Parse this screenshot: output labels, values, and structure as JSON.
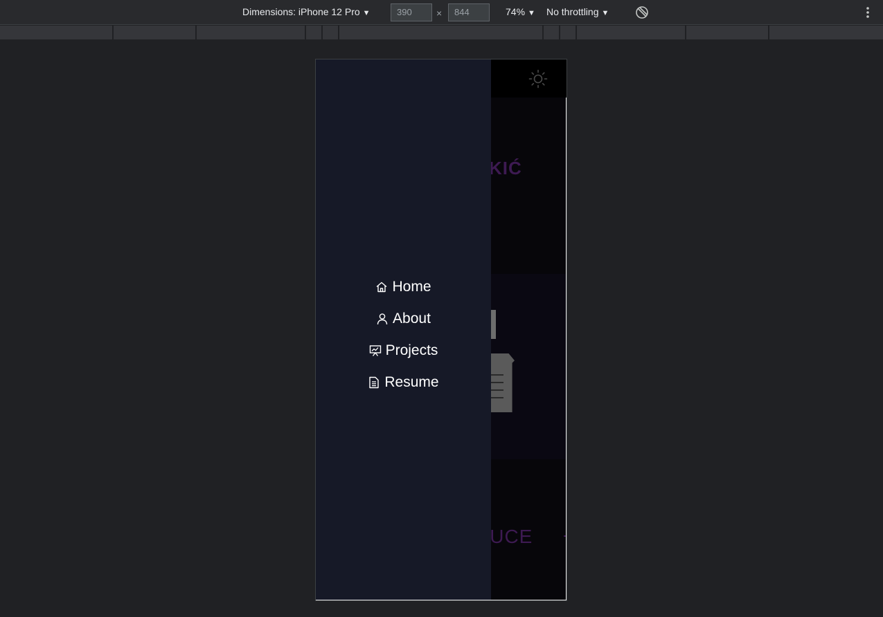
{
  "devtools": {
    "dimensions_label": "Dimensions: iPhone 12 Pro",
    "width_value": "390",
    "height_value": "844",
    "times_symbol": "×",
    "zoom_label": "74%",
    "throttling_label": "No throttling",
    "caret": "▼",
    "icons": {
      "rotate": "rotate-icon",
      "more": "more-vert-icon"
    }
  },
  "site": {
    "header": {
      "theme_icon": "sun-icon"
    },
    "hero_name_fragment": "KIĆ",
    "intro_fragment": "DUCE",
    "accent_color": "#3d1a52"
  },
  "drawer": {
    "background_color": "#161927",
    "items": [
      {
        "label": "Home",
        "icon": "home-icon"
      },
      {
        "label": "About",
        "icon": "user-icon"
      },
      {
        "label": "Projects",
        "icon": "presentation-icon"
      },
      {
        "label": "Resume",
        "icon": "document-icon"
      }
    ]
  }
}
